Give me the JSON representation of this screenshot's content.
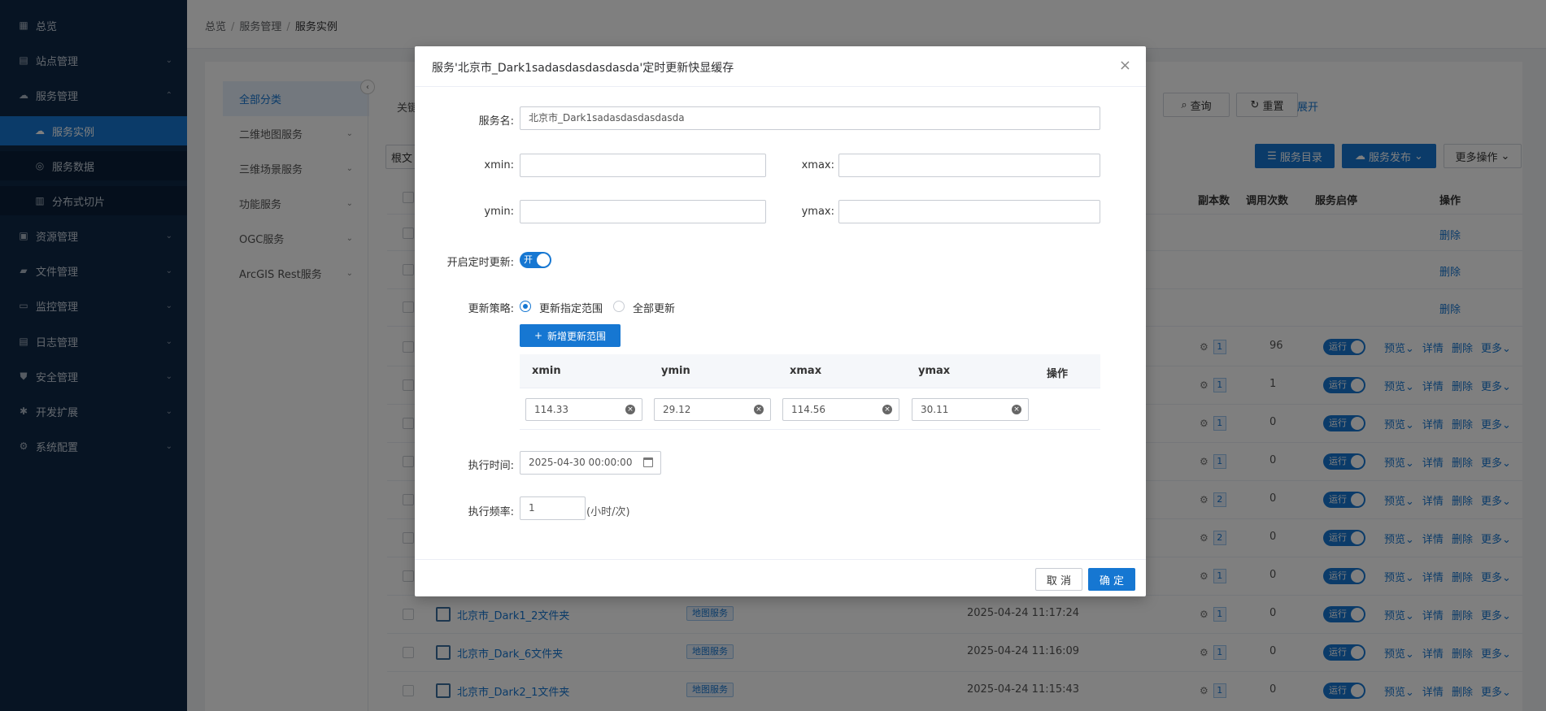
{
  "sidebar": {
    "items": [
      {
        "label": "总览",
        "icon": "grid-icon",
        "arrow": ""
      },
      {
        "label": "站点管理",
        "icon": "site-icon",
        "arrow": "⌄"
      },
      {
        "label": "服务管理",
        "icon": "cloud-icon",
        "arrow": "⌃"
      },
      {
        "label": "服务实例",
        "icon": "cloud-instance-icon",
        "arrow": ""
      },
      {
        "label": "服务数据",
        "icon": "data-icon",
        "arrow": ""
      },
      {
        "label": "分布式切片",
        "icon": "slice-icon",
        "arrow": ""
      },
      {
        "label": "资源管理",
        "icon": "resource-icon",
        "arrow": "⌄"
      },
      {
        "label": "文件管理",
        "icon": "folder-icon",
        "arrow": "⌄"
      },
      {
        "label": "监控管理",
        "icon": "monitor-icon",
        "arrow": "⌄"
      },
      {
        "label": "日志管理",
        "icon": "log-icon",
        "arrow": "⌄"
      },
      {
        "label": "安全管理",
        "icon": "shield-icon",
        "arrow": "⌄"
      },
      {
        "label": "开发扩展",
        "icon": "extension-icon",
        "arrow": "⌄"
      },
      {
        "label": "系统配置",
        "icon": "gear-icon",
        "arrow": "⌄"
      }
    ]
  },
  "breadcrumb": {
    "a": "总览",
    "b": "服务管理",
    "c": "服务实例"
  },
  "categories": [
    {
      "label": "全部分类",
      "arrow": ""
    },
    {
      "label": "二维地图服务",
      "arrow": "⌄"
    },
    {
      "label": "三维场景服务",
      "arrow": "⌄"
    },
    {
      "label": "功能服务",
      "arrow": "⌄"
    },
    {
      "label": "OGC服务",
      "arrow": "⌄"
    },
    {
      "label": "ArcGIS Rest服务",
      "arrow": "⌄"
    }
  ],
  "toolbar": {
    "keyword_label": "关键",
    "query": "查询",
    "reset": "重置",
    "expand": "展开",
    "root_label": "根文",
    "service_catalog": "服务目录",
    "service_publish": "服务发布",
    "more_ops": "更多操作"
  },
  "table": {
    "headers": {
      "replicas": "副本数",
      "calls": "调用次数",
      "status": "服务启停",
      "ops": "操作"
    },
    "delete_only": "删除",
    "run_label": "运行",
    "op_preview": "预览",
    "op_detail": "详情",
    "op_delete": "删除",
    "op_more": "更多",
    "rows": [
      {
        "replicas": "1",
        "calls": "96"
      },
      {
        "replicas": "1",
        "calls": "1"
      },
      {
        "replicas": "1",
        "calls": "0"
      },
      {
        "replicas": "1",
        "calls": "0"
      },
      {
        "replicas": "2",
        "calls": "0"
      },
      {
        "replicas": "2",
        "calls": "0"
      },
      {
        "replicas": "1",
        "calls": "0"
      },
      {
        "replicas": "1",
        "calls": "0",
        "name": "北京市_Dark1_2文件夹",
        "type": "地图服务",
        "time": "2025-04-24 11:17:24"
      },
      {
        "replicas": "1",
        "calls": "0",
        "name": "北京市_Dark_6文件夹",
        "type": "地图服务",
        "time": "2025-04-24 11:16:09"
      },
      {
        "replicas": "1",
        "calls": "0",
        "name": "北京市_Dark2_1文件夹",
        "type": "地图服务",
        "time": "2025-04-24 11:15:43"
      }
    ]
  },
  "modal": {
    "title": "服务'北京市_Dark1sadasdasdasdasda'定时更新快显缓存",
    "close": "×",
    "service_name_label": "服务名:",
    "service_name_value": "北京市_Dark1sadasdasdasdasda",
    "xmin_label": "xmin:",
    "xmax_label": "xmax:",
    "ymin_label": "ymin:",
    "ymax_label": "ymax:",
    "timer_label": "开启定时更新:",
    "timer_on": "开",
    "strategy_label": "更新策略:",
    "strategy_range": "更新指定范围",
    "strategy_all": "全部更新",
    "add_range": "新增更新范围",
    "range_headers": {
      "xmin": "xmin",
      "ymin": "ymin",
      "xmax": "xmax",
      "ymax": "ymax",
      "ops": "操作"
    },
    "range_values": {
      "xmin": "114.33",
      "ymin": "29.12",
      "xmax": "114.56",
      "ymax": "30.11"
    },
    "exec_time_label": "执行时间:",
    "exec_time_value": "2025-04-30 00:00:00",
    "freq_label": "执行频率:",
    "freq_value": "1",
    "freq_unit": "(小时/次)",
    "cancel": "取 消",
    "ok": "确 定"
  }
}
